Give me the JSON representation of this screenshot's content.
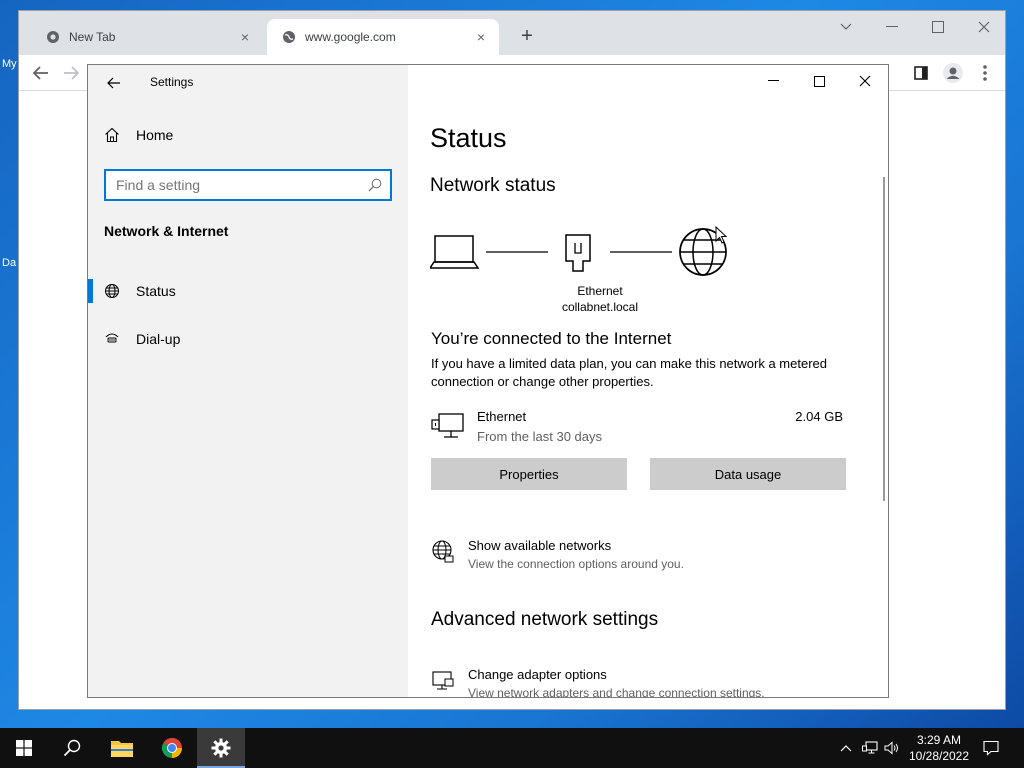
{
  "desktop": {
    "label_1": "My",
    "label_2": "Da"
  },
  "browser": {
    "tabs": [
      {
        "title": "New Tab"
      },
      {
        "title": "www.google.com"
      }
    ],
    "new_tab_symbol": "+",
    "close_symbol": "×"
  },
  "settings": {
    "app_title": "Settings",
    "home_label": "Home",
    "search": {
      "placeholder": "Find a setting",
      "value": ""
    },
    "section_title": "Network & Internet",
    "nav_items": [
      {
        "label": "Status",
        "icon": "globe-icon",
        "active": true
      },
      {
        "label": "Dial-up",
        "icon": "dial-up-icon",
        "active": false
      }
    ],
    "page_title": "Status",
    "network_status_heading": "Network status",
    "diagram": {
      "adapter_name": "Ethernet",
      "domain": "collabnet.local"
    },
    "connected_title": "You’re connected to the Internet",
    "connected_description": "If you have a limited data plan, you can make this network a metered connection or change other properties.",
    "connection": {
      "name": "Ethernet",
      "period": "From the last 30 days",
      "usage": "2.04 GB"
    },
    "buttons": {
      "properties": "Properties",
      "data_usage": "Data usage"
    },
    "show_networks": {
      "title": "Show available networks",
      "subtitle": "View the connection options around you."
    },
    "advanced_heading": "Advanced network settings",
    "adapter_options": {
      "title": "Change adapter options",
      "subtitle": "View network adapters and change connection settings."
    }
  },
  "taskbar": {
    "time": "3:29 AM",
    "date": "10/28/2022",
    "pinned": [
      "start-icon",
      "search-icon",
      "file-explorer-icon",
      "chrome-icon",
      "settings-gear-icon"
    ]
  },
  "colors": {
    "accent": "#0078d7",
    "nav_background": "#f2f2f2",
    "button_background": "#cccccc",
    "taskbar": "#101010"
  }
}
